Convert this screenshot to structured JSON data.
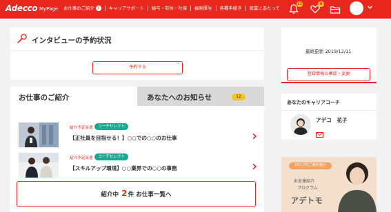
{
  "header": {
    "logo": "Adecco",
    "logo_sub": "MyPage",
    "nav": [
      {
        "label": "お仕事のご紹介",
        "count": "2"
      },
      {
        "label": "キャリアサポート"
      },
      {
        "label": "給与・有休・社保"
      },
      {
        "label": "福利厚生"
      },
      {
        "label": "各種手続き"
      },
      {
        "label": "就業にあたって"
      }
    ],
    "notifications_badge": "12",
    "favorites_badge": "0",
    "icons": [
      "bell-icon",
      "heart-icon",
      "folder-icon",
      "user-avatar",
      "chevron-down-icon"
    ],
    "accent_color": "#e8281e"
  },
  "interview": {
    "title": "インタビューの予約状況",
    "icon": "microphone-icon",
    "reserve_label": "予約する"
  },
  "jobs": {
    "tab_active": "お仕事のご紹介",
    "tab_inactive": "あなたへのお知らせ",
    "notice_count": "12",
    "items": [
      {
        "tag_type": "紹介予定派遣",
        "tag_select": "コーチセレクト",
        "title": "【正社員を目指せる！】○○での○○のお仕事"
      },
      {
        "tag_type": "紹介予定派遣",
        "tag_select": "コーチセレクト",
        "title": "【スキルアップ環境】○○業界での○○の事務"
      }
    ],
    "list_prefix": "紹介中",
    "list_count": "2",
    "list_suffix": "件 お仕事一覧へ"
  },
  "profile": {
    "updated": "最終更新 2019/12/11",
    "confirm_label": "登録情報の確認・変更"
  },
  "coach": {
    "heading": "あなたのキャリアコーチ",
    "name": "アデコ　花子"
  },
  "banner": {
    "pill": "1件1万円ご優待/紹介",
    "line1": "お友達紹介",
    "line2": "プログラム",
    "name": "アデトモ"
  }
}
